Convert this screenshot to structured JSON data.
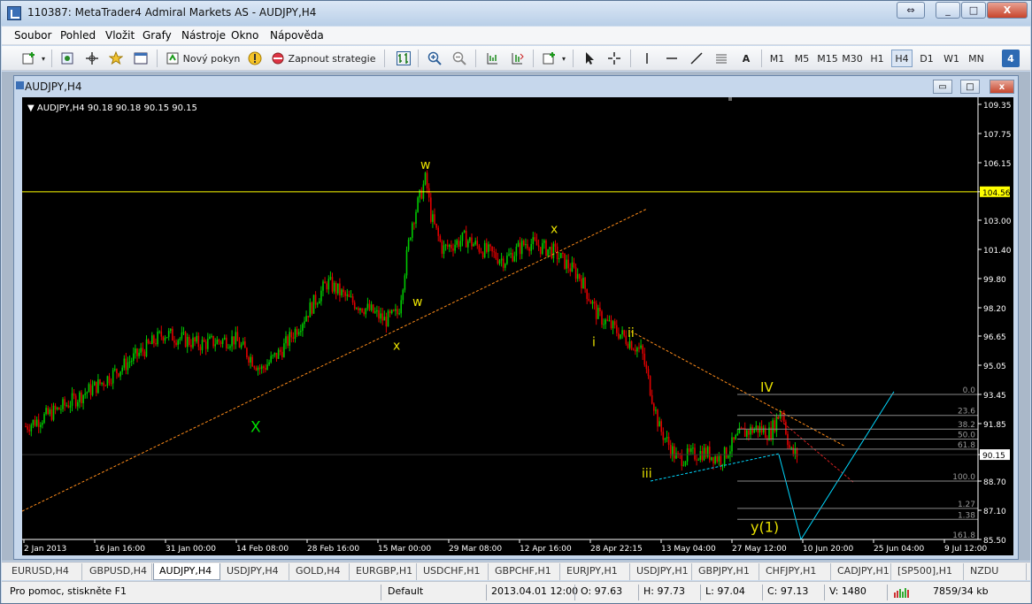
{
  "window": {
    "title": "110387: MetaTrader4 Admiral Markets AS - AUDJPY,H4",
    "min_label": "_",
    "max_label": "□",
    "close_label": "X",
    "restore_label": "⇔"
  },
  "menu": [
    "Soubor",
    "Pohled",
    "Vložit",
    "Grafy",
    "Nástroje",
    "Okno",
    "Nápověda"
  ],
  "toolbar": {
    "new_order": "Nový pokyn",
    "autotrading": "Zapnout strategie",
    "text_tool": "A",
    "timeframes": [
      "M1",
      "M5",
      "M15",
      "M30",
      "H1",
      "H4",
      "D1",
      "W1",
      "MN"
    ],
    "active_timeframe": "H4",
    "badge": "4"
  },
  "chart_window": {
    "title": "AUDJPY,H4",
    "min_label": "▭",
    "max_label": "□",
    "close_label": "x"
  },
  "chart_data": {
    "type": "line",
    "info": "▼ AUDJPY,H4  90.18 90.18 90.15 90.15",
    "price_axis": [
      "109.35",
      "107.75",
      "106.15",
      "104.56",
      "103.00",
      "101.40",
      "99.80",
      "98.20",
      "96.65",
      "95.05",
      "93.45",
      "91.85",
      "90.15",
      "88.70",
      "87.10",
      "85.50"
    ],
    "ylim": [
      85.5,
      109.35
    ],
    "horizontal_line": "104.56",
    "current_price": "90.15",
    "time_axis": [
      "2 Jan 2013",
      "16 Jan 16:00",
      "31 Jan 00:00",
      "14 Feb 08:00",
      "28 Feb 16:00",
      "15 Mar 00:00",
      "29 Mar 08:00",
      "12 Apr 16:00",
      "28 Apr 22:15",
      "13 May 04:00",
      "27 May 12:00",
      "10 Jun 20:00",
      "25 Jun 04:00",
      "9 Jul 12:00"
    ],
    "fibo_levels": [
      "0.0",
      "23.6",
      "38.2",
      "50.0",
      "61.8",
      "100.0",
      "1.27",
      "1.38",
      "161.8"
    ],
    "wave_labels": [
      "X",
      "w",
      "x",
      "w",
      "x",
      "i",
      "ii",
      "iii",
      "IV",
      "y(1)"
    ],
    "colors": {
      "bull": "#00c800",
      "bear": "#e00000",
      "hline": "#ffff00",
      "trend": "#ff8c1a",
      "projection": "#00d8ff",
      "grid": "#333333",
      "label_yellow": "#e8e000",
      "label_green": "#00e000"
    }
  },
  "tabs": [
    "EURUSD,H4",
    "GBPUSD,H4",
    "AUDJPY,H4",
    "USDJPY,H4",
    "GOLD,H4",
    "EURGBP,H1",
    "USDCHF,H1",
    "GBPCHF,H1",
    "EURJPY,H1",
    "USDJPY,H1",
    "GBPJPY,H1",
    "CHFJPY,H1",
    "CADJPY,H1",
    "[SP500],H1",
    "NZDU"
  ],
  "active_tab": "AUDJPY,H4",
  "status": {
    "help": "Pro pomoc, stiskněte F1",
    "profile": "Default",
    "datetime": "2013.04.01 12:00",
    "open": "O: 97.63",
    "high": "H: 97.73",
    "low": "L: 97.04",
    "close": "C: 97.13",
    "volume": "V: 1480",
    "traffic": "7859/34 kb"
  }
}
